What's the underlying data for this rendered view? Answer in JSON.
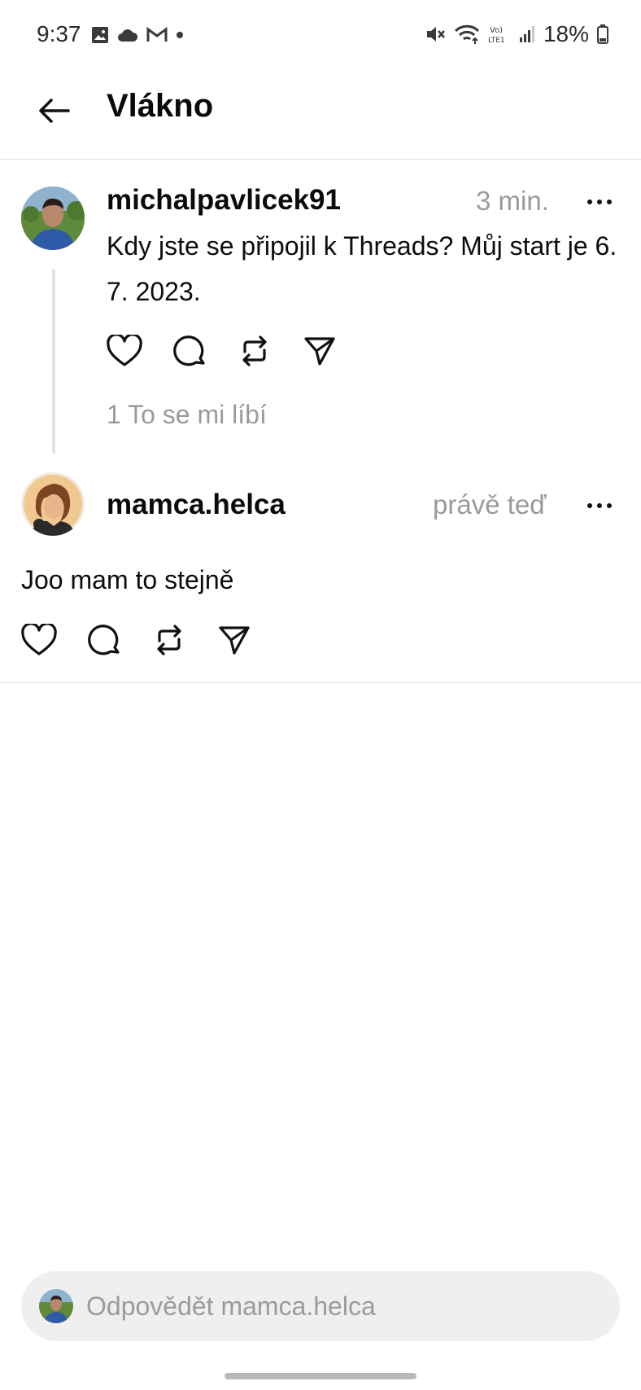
{
  "status_bar": {
    "time": "9:37",
    "battery": "18%",
    "left_icons": [
      "image-icon",
      "cloud-icon",
      "gmail-icon",
      "dot-icon"
    ],
    "right_icons": [
      "mute-icon",
      "wifi-icon",
      "volte-icon",
      "signal-icon",
      "battery-icon"
    ]
  },
  "header": {
    "title": "Vlákno"
  },
  "post": {
    "username": "michalpavlicek91",
    "time": "3 min.",
    "text": "Kdy jste se připojil k Threads? Můj start je 6. 7. 2023.",
    "likes": "1 To se mi líbí"
  },
  "reply": {
    "username": "mamca.helca",
    "time": "právě teď",
    "text": "Joo mam to stejně"
  },
  "composer": {
    "placeholder": "Odpovědět mamca.helca"
  },
  "colors": {
    "text": "#0b0b0b",
    "muted": "#9a9a9a",
    "divider": "#dedede",
    "composer_bg": "#efefef"
  }
}
